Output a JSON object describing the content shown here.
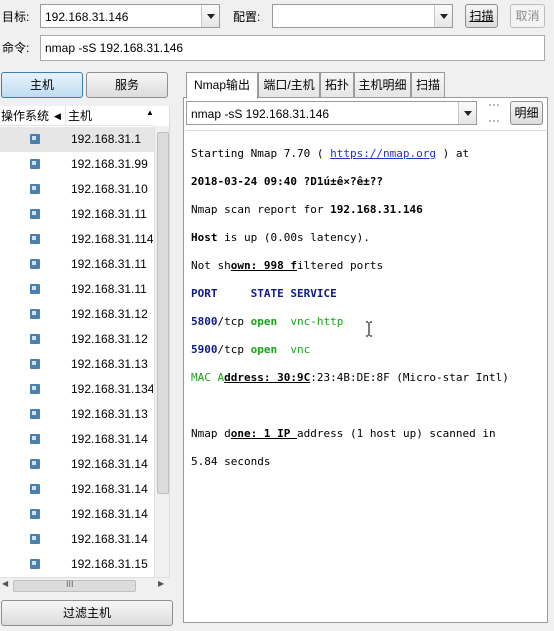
{
  "toolbar": {
    "target_label": "目标:",
    "target_value": "192.168.31.146",
    "profile_label": "配置:",
    "profile_value": "",
    "scan_label": "扫描",
    "cancel_label": "取消",
    "command_label": "命令:",
    "command_value": "nmap -sS 192.168.31.146"
  },
  "left": {
    "hosts_button": "主机",
    "services_button": "服务",
    "col_os": "操作系统",
    "col_host": "主机",
    "hosts": [
      "192.168.31.1",
      "192.168.31.99",
      "192.168.31.10",
      "192.168.31.11",
      "192.168.31.114",
      "192.168.31.11",
      "192.168.31.11",
      "192.168.31.12",
      "192.168.31.12",
      "192.168.31.13",
      "192.168.31.134",
      "192.168.31.13",
      "192.168.31.14",
      "192.168.31.14",
      "192.168.31.14",
      "192.168.31.14",
      "192.168.31.14",
      "192.168.31.15"
    ],
    "filter_button": "过滤主机"
  },
  "tabs": [
    "Nmap输出",
    "端口/主机",
    "拓扑",
    "主机明细",
    "扫描"
  ],
  "output": {
    "command_select": "nmap -sS 192.168.31.146",
    "details_button": "明细",
    "l1_a": "Starting Nmap 7.70 ( ",
    "l1_link": "https://nmap.org",
    "l1_b": " ) at",
    "l2": "2018-03-24 09:40 ?D1ú±ê×?ê±??",
    "l3_a": "Nmap scan report for ",
    "l3_b": "192.168.31.146",
    "l4_a": "Host",
    "l4_b": " is up (0.00s latency).",
    "l5_a": "Not sh",
    "l5_b": "own: 998 f",
    "l5_c": "iltered ports",
    "l6_port": "PORT",
    "l6_rest": "     STATE SERVICE",
    "r1_port": "5800",
    "r1_proto": "/tcp ",
    "r1_state": "open",
    "r1_svc": "  vnc-http",
    "r2_port": "5900",
    "r2_proto": "/tcp ",
    "r2_state": "open",
    "r2_svc": "  vnc",
    "l9_a": "MAC A",
    "l9_b": "ddress: 30:9C",
    "l9_c": ":23:4B:DE:8F (Micro-star Intl)",
    "l11_a": "Nmap d",
    "l11_b": "one: 1 IP ",
    "l11_c": "address (1 host up) scanned in",
    "l12": "5.84 seconds"
  },
  "scroll_grip": "III"
}
